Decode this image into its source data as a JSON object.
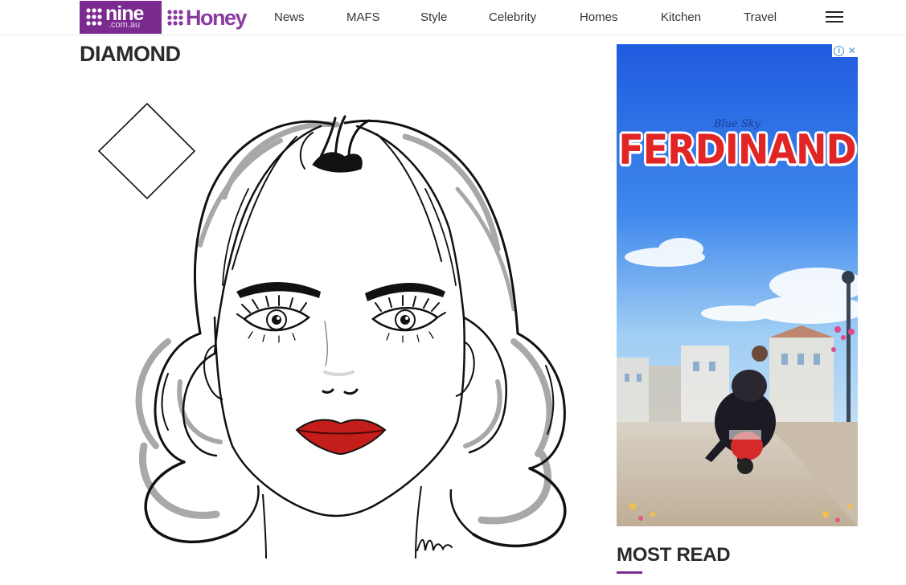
{
  "header": {
    "nine_logo": {
      "word": "nine",
      "domain": ".com.au"
    },
    "honey_logo": {
      "word": "Honey"
    },
    "nav": [
      {
        "label": "News"
      },
      {
        "label": "MAFS"
      },
      {
        "label": "Style"
      },
      {
        "label": "Celebrity"
      },
      {
        "label": "Homes"
      },
      {
        "label": "Kitchen"
      },
      {
        "label": "Travel"
      }
    ],
    "menu_icon": "hamburger-icon"
  },
  "article": {
    "heading": "DIAMOND",
    "illustration": {
      "subject": "face-shape-illustration",
      "shape_icon": "diamond-shape-icon",
      "signature": "Mw"
    }
  },
  "sidebar": {
    "ad": {
      "brand": "Blue Sky",
      "title": "FERDINAND",
      "choices_icon": "ad-choices-icon",
      "close_icon": "close-icon"
    },
    "most_read_heading": "MOST READ"
  },
  "colors": {
    "brand_purple": "#7b2b8f",
    "honey_purple": "#8a3aa0",
    "lip_red": "#c41e1a",
    "ad_title_red": "#e12424"
  }
}
